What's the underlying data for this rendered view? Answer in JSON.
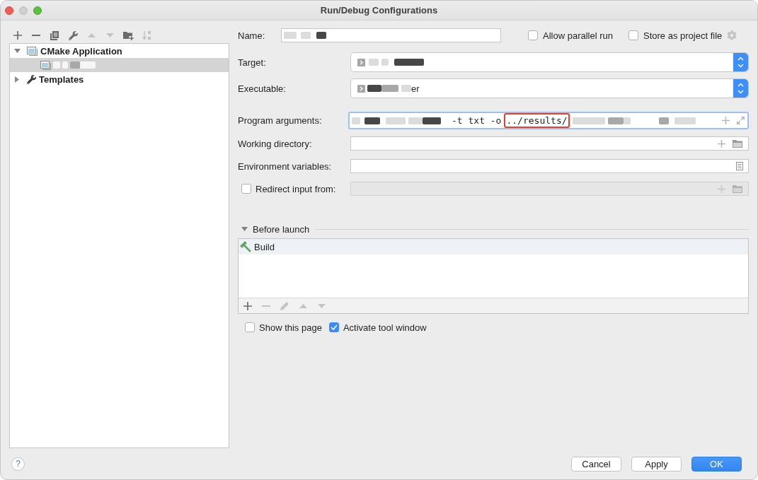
{
  "window": {
    "title": "Run/Debug Configurations",
    "controls": [
      {
        "kind": "close",
        "disabled": false
      },
      {
        "kind": "minimize",
        "disabled": true
      },
      {
        "kind": "zoom",
        "disabled": false
      }
    ]
  },
  "toolbar": [
    {
      "kind": "add",
      "disabled": false
    },
    {
      "kind": "remove",
      "disabled": false
    },
    {
      "kind": "copy",
      "disabled": false
    },
    {
      "kind": "configure",
      "disabled": false
    },
    {
      "kind": "up",
      "disabled": true
    },
    {
      "kind": "down",
      "disabled": true
    },
    {
      "kind": "folder",
      "disabled": false
    },
    {
      "kind": "sort",
      "disabled": true
    }
  ],
  "tree": [
    {
      "kind": "group",
      "label": "CMake Application",
      "expanded": true,
      "selected": false,
      "children": [
        {
          "kind": "config",
          "selected": true
        }
      ]
    },
    {
      "kind": "templates",
      "label": "Templates",
      "expanded": false,
      "selected": false
    }
  ],
  "form": {
    "name": {
      "label": "Name:"
    },
    "options": [
      {
        "label": "Allow parallel run",
        "checked": false
      },
      {
        "label": "Store as project file",
        "checked": false
      }
    ],
    "target": {
      "label": "Target:"
    },
    "executable": {
      "label": "Executable:",
      "value": "er"
    },
    "program_arguments": {
      "label": "Program arguments:",
      "value": "-t txt -o",
      "highlight": "../results/"
    },
    "working_directory": {
      "label": "Working directory:"
    },
    "environment_variables": {
      "label": "Environment variables:"
    },
    "redirect_input": {
      "label": "Redirect input from:",
      "checked": false
    }
  },
  "before_launch": {
    "title": "Before launch",
    "expanded": true,
    "tasks": [
      {
        "kind": "build",
        "label": "Build",
        "selected": true
      }
    ],
    "toolbar": [
      {
        "kind": "add",
        "disabled": false
      },
      {
        "kind": "remove",
        "disabled": true
      },
      {
        "kind": "edit",
        "disabled": true
      },
      {
        "kind": "up",
        "disabled": true
      },
      {
        "kind": "down",
        "disabled": true
      }
    ]
  },
  "launch_options": [
    {
      "label": "Show this page",
      "checked": false
    },
    {
      "label": "Activate tool window",
      "checked": true
    }
  ],
  "help": {
    "label": "?"
  },
  "buttons": [
    {
      "kind": "secondary",
      "label": "Cancel"
    },
    {
      "kind": "secondary",
      "label": "Apply"
    },
    {
      "kind": "primary",
      "label": "OK"
    }
  ]
}
